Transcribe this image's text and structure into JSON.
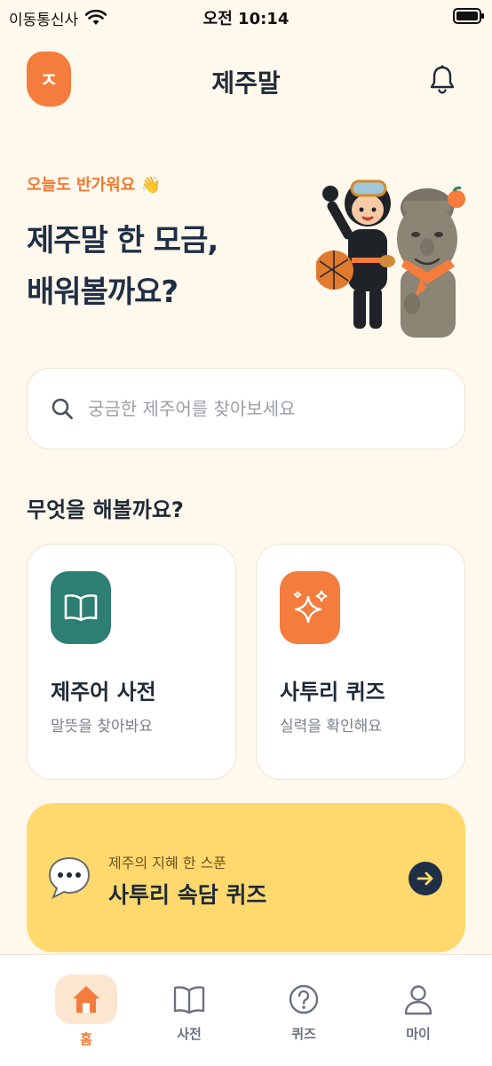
{
  "status_bar": {
    "carrier": "이동통신사",
    "time": "오전 10:14"
  },
  "header": {
    "logo_letter": "ㅈ",
    "title": "제주말"
  },
  "hero": {
    "greeting": "오늘도 반가워요 👋",
    "title_line1": "제주말 한 모금,",
    "title_line2": "배워볼까요?"
  },
  "search": {
    "placeholder": "궁금한 제주어를 찾아보세요"
  },
  "section": {
    "title": "무엇을 해볼까요?"
  },
  "cards": [
    {
      "title": "제주어 사전",
      "subtitle": "말뜻을 찾아봐요",
      "icon": "book-icon"
    },
    {
      "title": "사투리 퀴즈",
      "subtitle": "실력을 확인해요",
      "icon": "sparkle-icon"
    }
  ],
  "banner": {
    "subtitle": "제주의 지혜 한 스푼",
    "title": "사투리 속담 퀴즈",
    "icon": "chat-bubble-icon"
  },
  "tabs": [
    {
      "label": "홈",
      "icon": "home-icon",
      "active": true
    },
    {
      "label": "사전",
      "icon": "book-icon",
      "active": false
    },
    {
      "label": "퀴즈",
      "icon": "question-icon",
      "active": false
    },
    {
      "label": "마이",
      "icon": "user-icon",
      "active": false
    }
  ],
  "colors": {
    "background": "#FFF8EC",
    "accent": "#F47C3C",
    "teal": "#2D7F73",
    "banner": "#FFD96E",
    "navy": "#1F2F45"
  }
}
